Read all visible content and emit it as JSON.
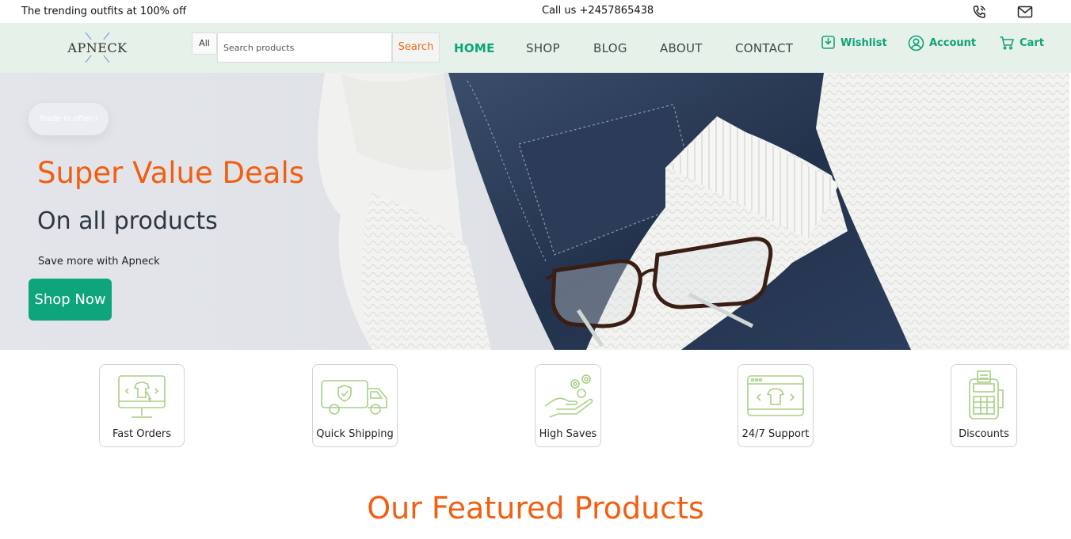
{
  "topbar": {
    "promo": "The trending outfits at 100% off",
    "phone": "Call us +2457865438",
    "icons": [
      "phone-icon",
      "mail-icon"
    ]
  },
  "header": {
    "logo": "APNECK",
    "search": {
      "category": "All",
      "placeholder": "Search products",
      "button": "Search"
    },
    "nav": [
      "HOME",
      "SHOP",
      "BLOG",
      "ABOUT",
      "CONTACT"
    ],
    "active_nav": "HOME",
    "actions": {
      "wishlist": "Wishlist",
      "account": "Account",
      "cart": "Cart"
    }
  },
  "hero": {
    "badge": "Trade in offer!!",
    "title": "Super Value Deals",
    "subtitle": "On all products",
    "tagline": "Save more with Apneck",
    "cta": "Shop Now"
  },
  "features": [
    {
      "label": "Fast Orders",
      "icon": "monitor-shirt-icon"
    },
    {
      "label": "Quick Shipping",
      "icon": "delivery-truck-icon"
    },
    {
      "label": "High Saves",
      "icon": "coin-hand-icon"
    },
    {
      "label": "24/7 Support",
      "icon": "browser-shirt-icon"
    },
    {
      "label": "Discounts",
      "icon": "pos-terminal-icon"
    }
  ],
  "featured_heading": "Our Featured Products",
  "colors": {
    "accent_green": "#0ea47c",
    "accent_orange": "#f05f12",
    "header_bg": "#e6f1ea",
    "icon_green": "#a9cf86"
  }
}
